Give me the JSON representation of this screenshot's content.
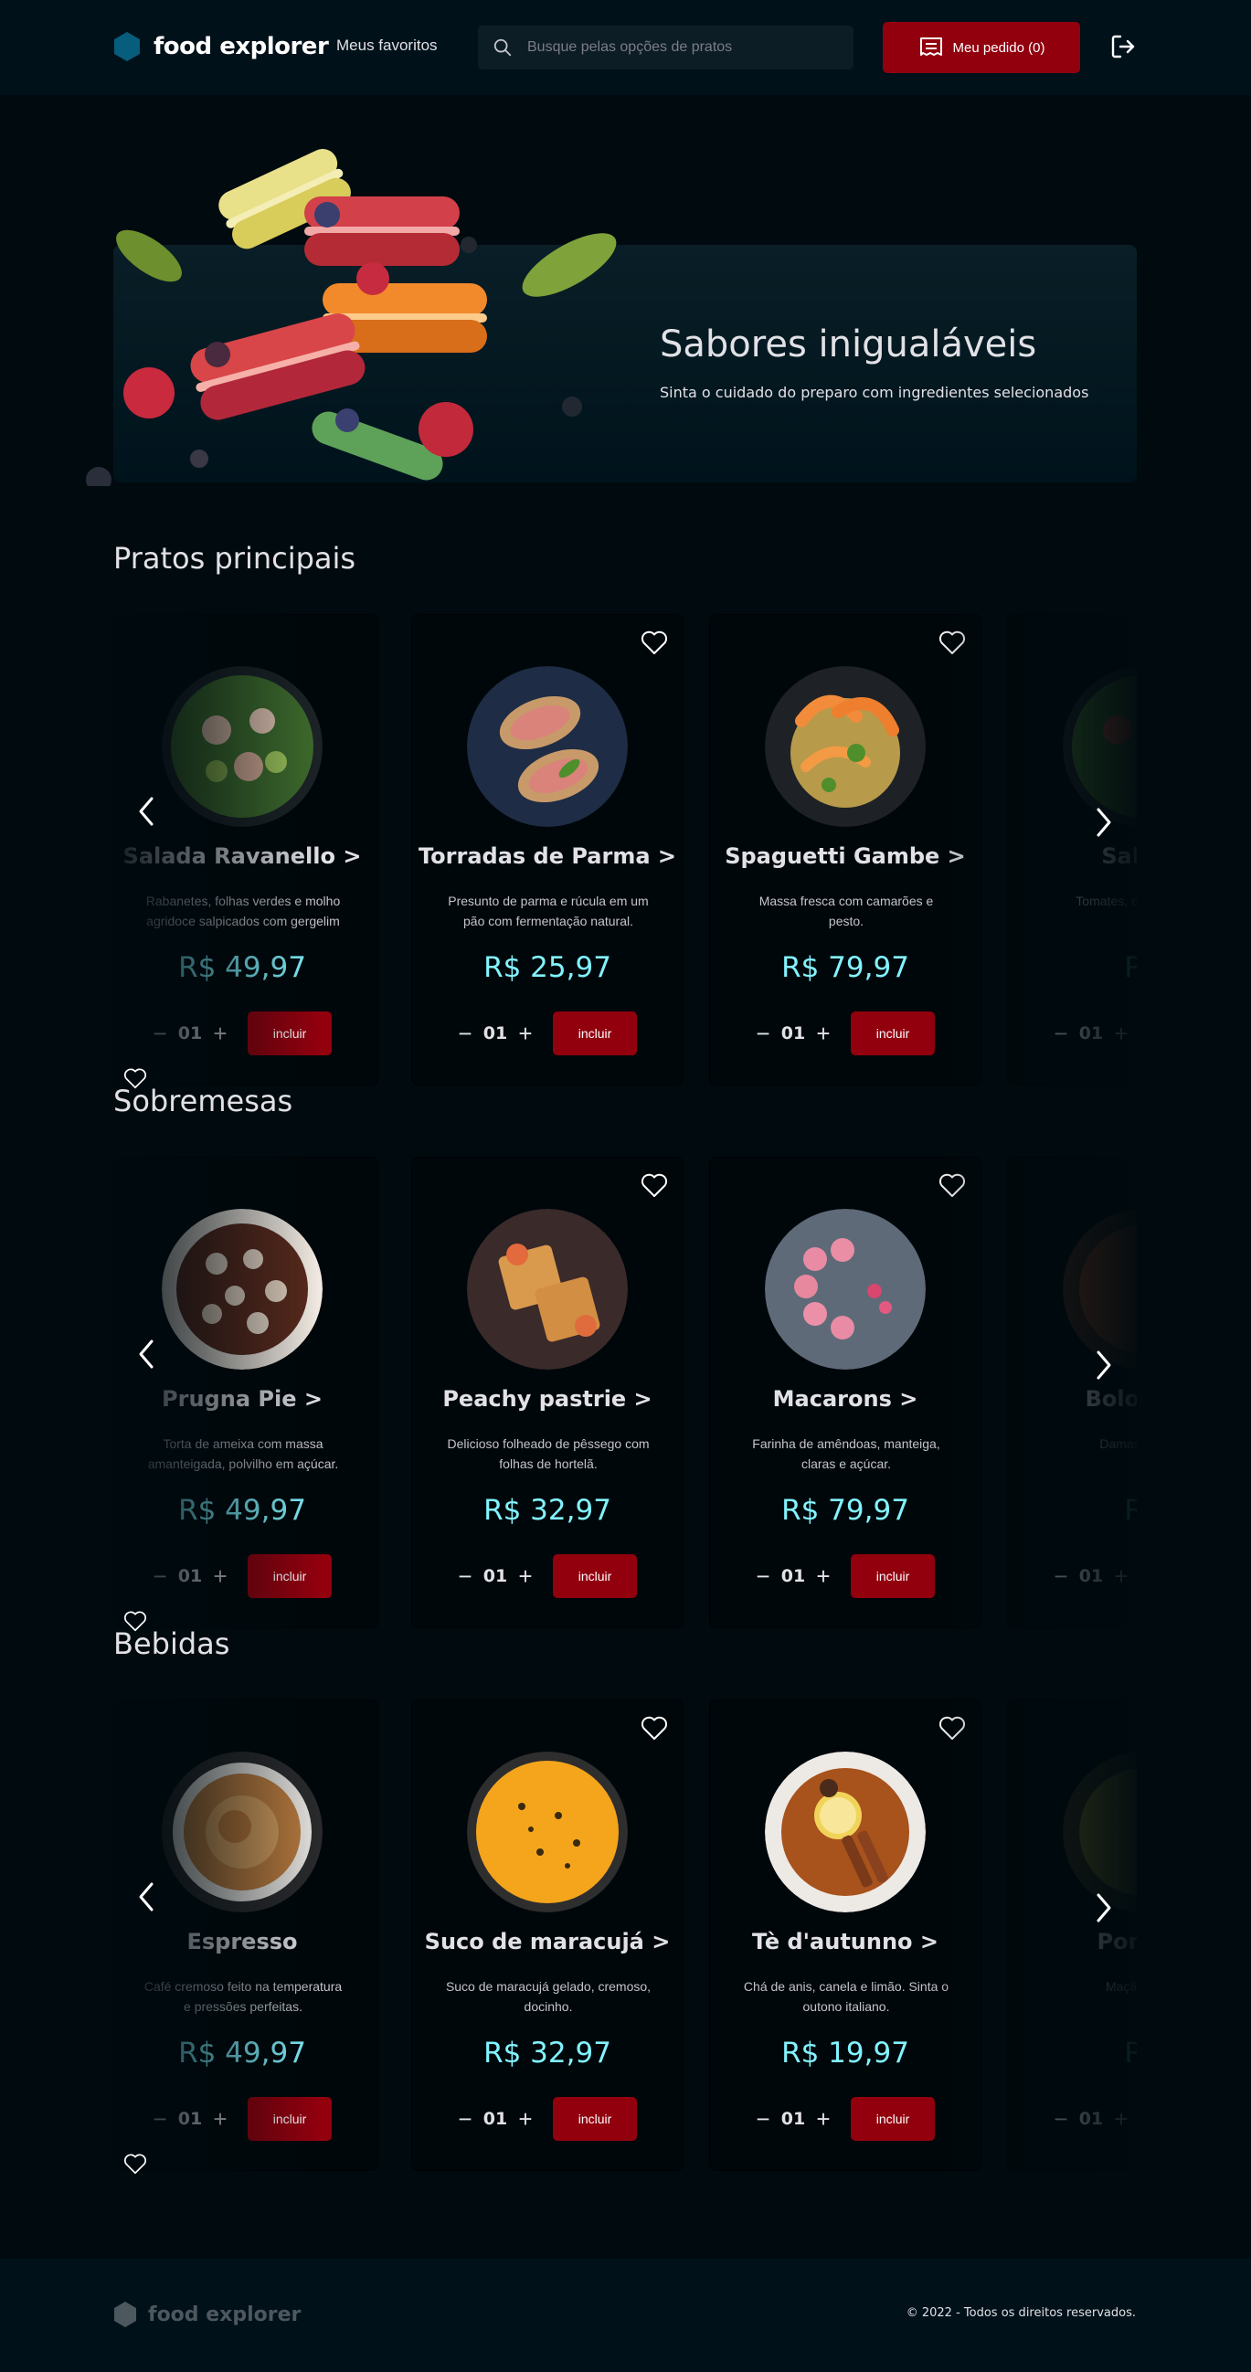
{
  "header": {
    "brand": "food explorer",
    "favorites_link": "Meus favoritos",
    "search_placeholder": "Busque pelas opções de pratos",
    "order_button": "Meu pedido (0)",
    "brand_color": "#065E7C",
    "accent_color": "#92000E"
  },
  "banner": {
    "title": "Sabores inigualáveis",
    "subtitle": "Sinta o cuidado do preparo com ingredientes selecionados"
  },
  "sections": [
    {
      "title": "Pratos principais",
      "cards": [
        {
          "name": "Salada Ravanello >",
          "description": "Rabanetes, folhas verdes e molho agridoce salpicados com gergelim",
          "price": "R$ 49,97",
          "quantity": "01",
          "button": "incluir",
          "image": "salad-plate"
        },
        {
          "name": "Torradas de Parma >",
          "description": "Presunto de parma e rúcula em um pão com fermentação natural.",
          "price": "R$ 25,97",
          "quantity": "01",
          "button": "incluir",
          "image": "parma-toast-plate"
        },
        {
          "name": "Spaguetti Gambe  >",
          "description": "Massa fresca com camarões e pesto.",
          "price": "R$ 79,97",
          "quantity": "01",
          "button": "incluir",
          "image": "shrimp-pasta-plate"
        },
        {
          "name": "Salada",
          "description": "Tomates, co roxa. Fresc",
          "price": "R$",
          "quantity": "01",
          "button": "incluir",
          "image": "salad-plate"
        }
      ]
    },
    {
      "title": "Sobremesas",
      "cards": [
        {
          "name": "Prugna Pie >",
          "description": "Torta de ameixa com massa amanteigada, polvilho em açúcar.",
          "price": "R$ 49,97",
          "quantity": "01",
          "button": "incluir",
          "image": "plum-pie"
        },
        {
          "name": "Peachy pastrie >",
          "description": "Delicioso folheado de pêssego com folhas de hortelã.",
          "price": "R$ 32,97",
          "quantity": "01",
          "button": "incluir",
          "image": "peach-pastry"
        },
        {
          "name": "Macarons  >",
          "description": "Farinha de amêndoas, manteiga, claras e açúcar.",
          "price": "R$ 79,97",
          "quantity": "01",
          "button": "incluir",
          "image": "macarons-plate"
        },
        {
          "name": "Bolo de d",
          "description": "Damascos fr se",
          "price": "R$",
          "quantity": "01",
          "button": "incluir",
          "image": "cake"
        }
      ]
    },
    {
      "title": "Bebidas",
      "cards": [
        {
          "name": "Espresso",
          "description": "Café cremoso feito na temperatura e pressões perfeitas.",
          "price": "R$ 49,97",
          "quantity": "01",
          "button": "incluir",
          "image": "espresso-cup"
        },
        {
          "name": "Suco de maracujá >",
          "description": "Suco de maracujá gelado, cremoso, docinho.",
          "price": "R$ 32,97",
          "quantity": "01",
          "button": "incluir",
          "image": "passion-fruit-juice"
        },
        {
          "name": "Tè d'autunno >",
          "description": "Chá de anis, canela e limão. Sinta o outono italiano.",
          "price": "R$ 19,97",
          "quantity": "01",
          "button": "incluir",
          "image": "autumn-tea"
        },
        {
          "name": "Pomo b",
          "description": "Maçã, whisky",
          "price": "R$",
          "quantity": "01",
          "button": "incluir",
          "image": "apple-drink"
        }
      ]
    }
  ],
  "footer": {
    "brand": "food explorer",
    "copyright": "© 2022 - Todos os direitos reservados."
  }
}
